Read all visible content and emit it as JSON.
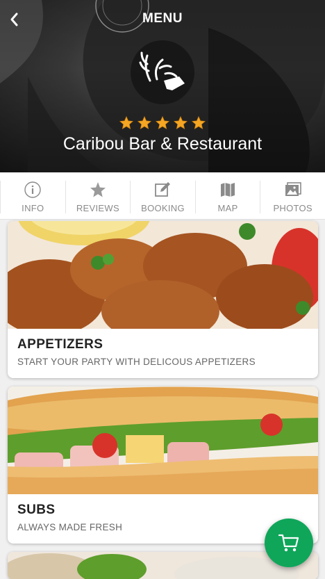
{
  "header": {
    "title": "MENU",
    "back_icon": "chevron-left-icon",
    "logo_icon": "deer-logo-icon",
    "rating": 5,
    "venue_name": "Caribou Bar & Restaurant",
    "star_color": "#f5a623"
  },
  "tabs": [
    {
      "label": "INFO",
      "icon": "info-icon"
    },
    {
      "label": "REVIEWS",
      "icon": "star-icon"
    },
    {
      "label": "BOOKING",
      "icon": "edit-icon"
    },
    {
      "label": "MAP",
      "icon": "map-icon"
    },
    {
      "label": "PHOTOS",
      "icon": "photos-icon"
    }
  ],
  "categories": [
    {
      "title": "APPETIZERS",
      "subtitle": "START YOUR PARTY WITH DELICOUS APPETIZERS"
    },
    {
      "title": "SUBS",
      "subtitle": "ALWAYS MADE FRESH"
    }
  ],
  "cart": {
    "icon": "cart-icon",
    "color": "#0fa65a"
  }
}
